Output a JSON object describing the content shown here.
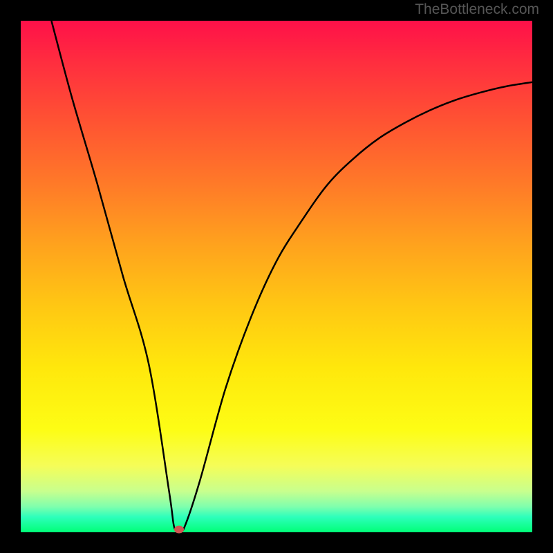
{
  "watermark": "TheBottleneck.com",
  "chart_data": {
    "type": "line",
    "title": "",
    "xlabel": "",
    "ylabel": "",
    "xlim": [
      0,
      100
    ],
    "ylim": [
      0,
      100
    ],
    "series": [
      {
        "name": "bottleneck-curve",
        "x": [
          6,
          10,
          15,
          20,
          25,
          29,
          30,
          31,
          32,
          35,
          40,
          45,
          50,
          55,
          60,
          65,
          70,
          75,
          80,
          85,
          90,
          95,
          100
        ],
        "values": [
          100,
          85,
          68,
          50,
          33,
          8,
          1,
          0.5,
          1,
          10,
          28,
          42,
          53,
          61,
          68,
          73,
          77,
          80,
          82.5,
          84.5,
          86,
          87.2,
          88
        ]
      }
    ],
    "marker": {
      "x": 31,
      "y": 0.5
    },
    "background_gradient": {
      "top": "#ff1049",
      "bottom": "#00ff77"
    }
  }
}
